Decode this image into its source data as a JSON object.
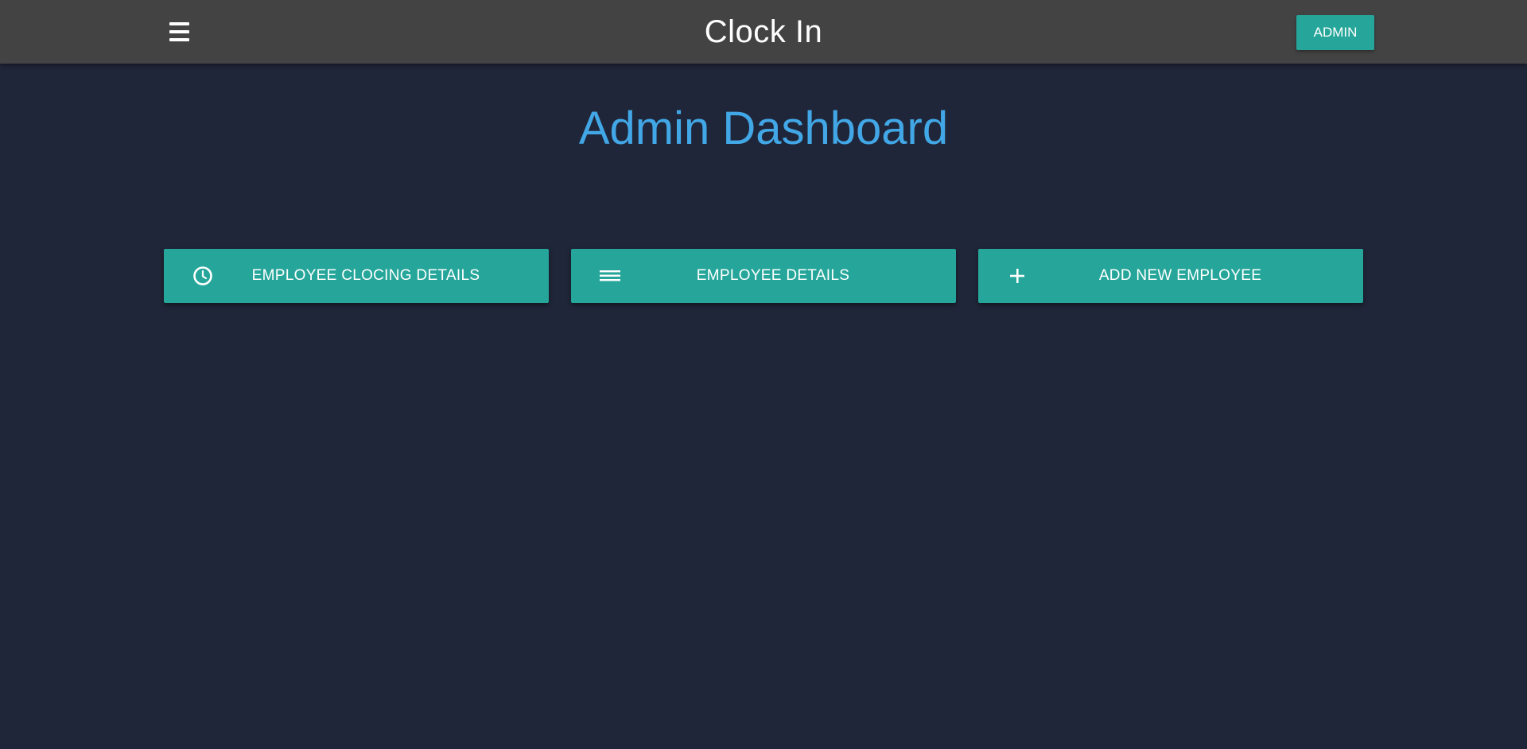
{
  "header": {
    "title": "Clock In",
    "menu_icon": "hamburger-menu-icon",
    "admin_label": "ADMIN"
  },
  "main": {
    "heading": "Admin Dashboard",
    "actions": [
      {
        "label": "EMPLOYEE CLOCING DETAILS",
        "icon": "clock-icon"
      },
      {
        "label": "EMPLOYEE DETAILS",
        "icon": "list-icon"
      },
      {
        "label": "ADD NEW EMPLOYEE",
        "icon": "plus-icon"
      }
    ]
  },
  "colors": {
    "background": "#202639",
    "topbar": "#434343",
    "accent": "#26a69a",
    "heading": "#42a7e6",
    "text_on_accent": "#ffffff"
  }
}
